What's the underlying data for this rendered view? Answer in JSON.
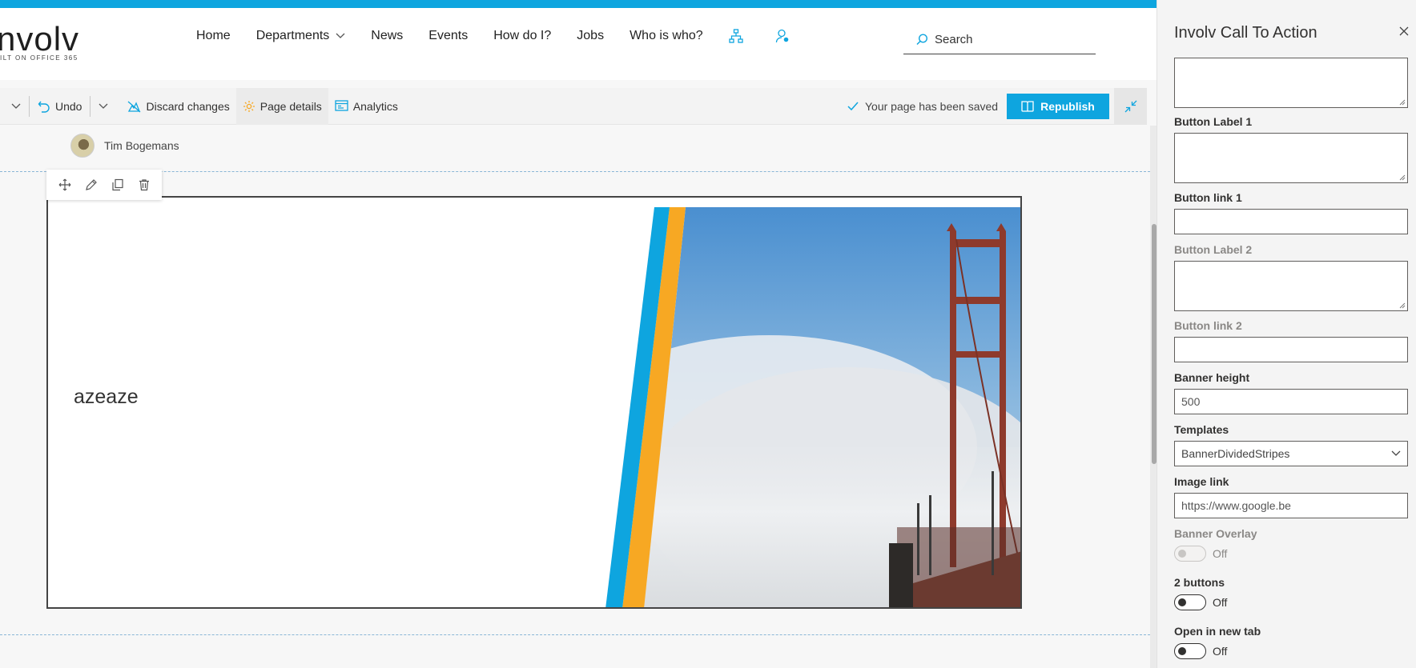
{
  "header": {
    "logo_text": "nvolv",
    "logo_sub": "ILT ON OFFICE 365",
    "nav": [
      "Home",
      "Departments",
      "News",
      "Events",
      "How do I?",
      "Jobs",
      "Who is who?"
    ],
    "search_placeholder": "Search"
  },
  "commandbar": {
    "undo": "Undo",
    "discard": "Discard changes",
    "page_details": "Page details",
    "analytics": "Analytics",
    "saved_status": "Your page has been saved",
    "republish": "Republish"
  },
  "page": {
    "author": "Tim Bogemans",
    "banner_title": "azeaze"
  },
  "panel": {
    "title": "Involv Call To Action",
    "button_label_1": "Button Label 1",
    "button_link_1": "Button link 1",
    "button_label_2": "Button Label 2",
    "button_link_2": "Button link 2",
    "banner_height_label": "Banner height",
    "banner_height_value": "500",
    "templates_label": "Templates",
    "templates_value": "BannerDividedStripes",
    "image_link_label": "Image link",
    "image_link_value": "https://www.google.be",
    "banner_overlay_label": "Banner Overlay",
    "banner_overlay_state": "Off",
    "two_buttons_label": "2 buttons",
    "two_buttons_state": "Off",
    "new_tab_label": "Open in new tab",
    "new_tab_state": "Off"
  },
  "colors": {
    "accent": "#0ea5df",
    "stripe_orange": "#f7a823",
    "stripe_blue": "#0ea5df"
  }
}
